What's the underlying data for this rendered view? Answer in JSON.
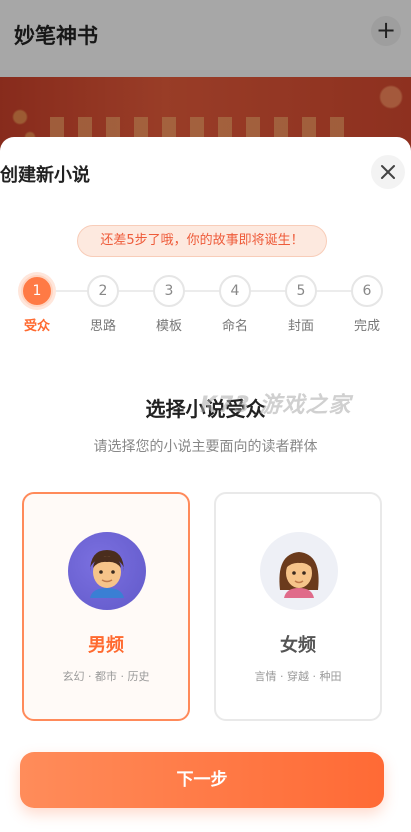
{
  "app": {
    "title": "妙笔神书",
    "add_label": "+"
  },
  "sheet": {
    "title": "创建新小说",
    "hint": "还差5步了哦，你的故事即将诞生！",
    "steps": [
      {
        "num": "1",
        "label": "受众",
        "active": true
      },
      {
        "num": "2",
        "label": "思路"
      },
      {
        "num": "3",
        "label": "模板"
      },
      {
        "num": "4",
        "label": "命名"
      },
      {
        "num": "5",
        "label": "封面"
      },
      {
        "num": "6",
        "label": "完成"
      }
    ],
    "heading": "选择小说受众",
    "subheading": "请选择您的小说主要面向的读者群体",
    "watermark": "K73 游戏之家",
    "cards": {
      "male": {
        "title": "男频",
        "tags": "玄幻 · 都市 · 历史",
        "selected": true
      },
      "female": {
        "title": "女频",
        "tags": "言情 · 穿越 · 种田"
      }
    },
    "next_label": "下一步"
  },
  "colors": {
    "accent": "#ff6a30",
    "accent_light": "#fde9df"
  }
}
